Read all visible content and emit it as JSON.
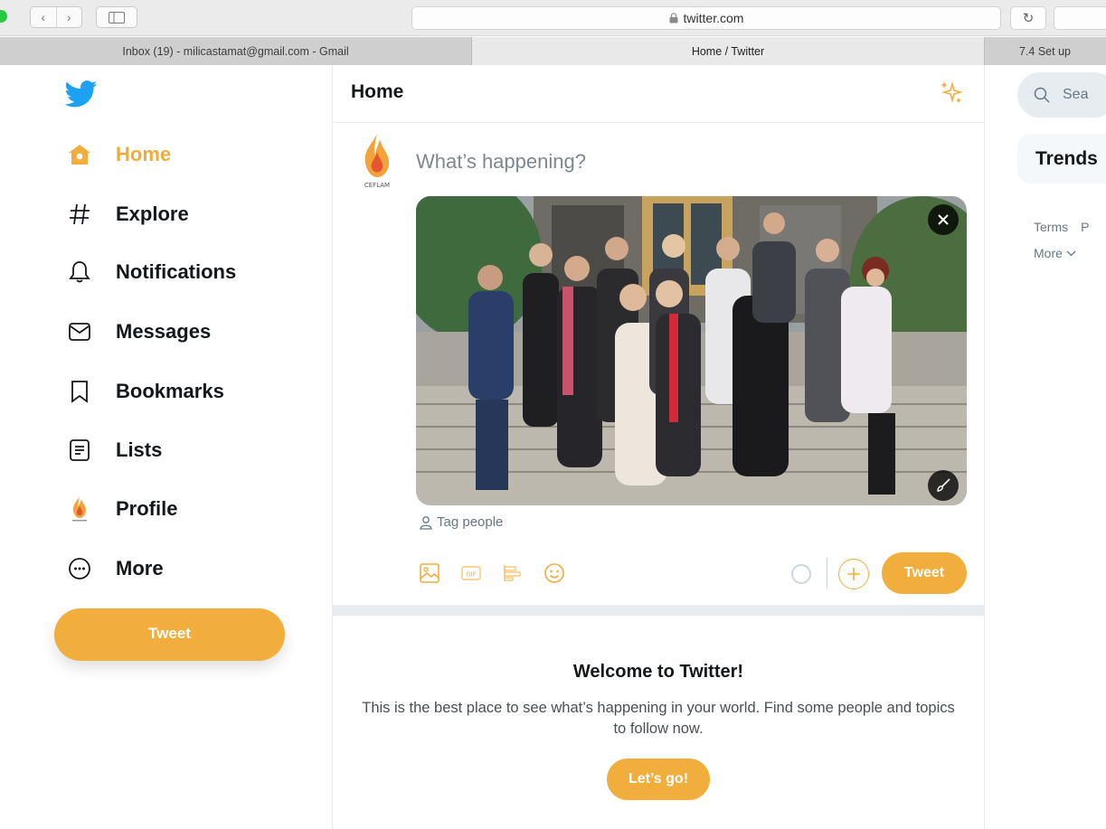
{
  "browser": {
    "url": "twitter.com",
    "tabs": [
      {
        "label": "Inbox (19) - milicastamat@gmail.com - Gmail"
      },
      {
        "label": "Home / Twitter"
      },
      {
        "label": "7.4 Set up"
      }
    ]
  },
  "nav": {
    "items": [
      {
        "label": "Home",
        "icon": "home-icon"
      },
      {
        "label": "Explore",
        "icon": "hashtag-icon"
      },
      {
        "label": "Notifications",
        "icon": "bell-icon"
      },
      {
        "label": "Messages",
        "icon": "envelope-icon"
      },
      {
        "label": "Bookmarks",
        "icon": "bookmark-icon"
      },
      {
        "label": "Lists",
        "icon": "list-icon"
      },
      {
        "label": "Profile",
        "icon": "profile-avatar-icon"
      },
      {
        "label": "More",
        "icon": "more-dots-icon"
      }
    ],
    "tweet_label": "Tweet",
    "avatar_text": "CEFLAM"
  },
  "header": {
    "title": "Home"
  },
  "composer": {
    "placeholder": "What’s happening?",
    "tag_people": "Tag people",
    "gif_label": "GIF",
    "tweet_label": "Tweet"
  },
  "welcome": {
    "title": "Welcome to Twitter!",
    "body": "This is the best place to see what’s happening in your world. Find some people and topics to follow now.",
    "button": "Let’s go!"
  },
  "right": {
    "search_placeholder": "Sea",
    "trends_title": "Trends",
    "links": [
      "Terms",
      "P"
    ],
    "more": "More"
  },
  "colors": {
    "accent": "#f2ae3c",
    "text": "#14171a",
    "muted": "#657786",
    "border": "#e6ecf0"
  }
}
